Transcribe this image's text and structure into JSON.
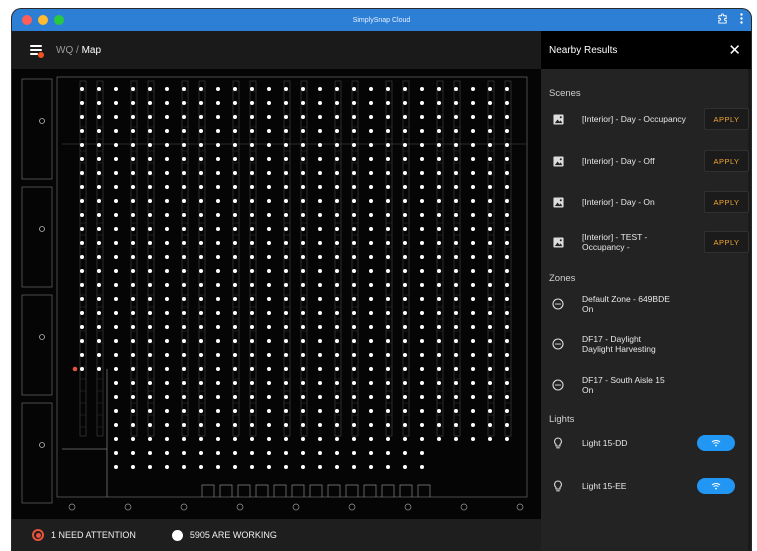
{
  "window": {
    "title": "SimplySnap Cloud",
    "icons": [
      "puzzle-icon",
      "kebab-menu-icon"
    ]
  },
  "appbar": {
    "breadcrumb_root": "WQ",
    "breadcrumb_sep": " / ",
    "breadcrumb_current": "Map"
  },
  "panel": {
    "title": "Nearby Results",
    "sections": {
      "scenes": "Scenes",
      "zones": "Zones",
      "lights": "Lights"
    },
    "scenes": [
      {
        "name": "[Interior] - Day - Occupancy",
        "action": "APPLY"
      },
      {
        "name": "[Interior] - Day - Off",
        "action": "APPLY"
      },
      {
        "name": "[Interior] - Day - On",
        "action": "APPLY"
      },
      {
        "name_line1": "[Interior] - TEST -",
        "name_line2": "Occupancy -",
        "action": "APPLY"
      }
    ],
    "zones": [
      {
        "line1": "Default Zone - 649BDE",
        "line2": "On"
      },
      {
        "line1": "DF17 - Daylight",
        "line2": "Daylight Harvesting"
      },
      {
        "line1": "DF17 - South Aisle 15",
        "line2": "On"
      }
    ],
    "lights": [
      {
        "name": "Light 15-DD",
        "status_icon": "wifi-icon"
      },
      {
        "name": "Light 15-EE",
        "status_icon": "wifi-icon"
      }
    ]
  },
  "status": {
    "attention": "1 NEED ATTENTION",
    "working": "5905 ARE WORKING"
  },
  "colors": {
    "accent": "#2196f3",
    "apply": "#f2a531",
    "attention": "#e8533b",
    "titlebar": "#2d7fd6"
  }
}
